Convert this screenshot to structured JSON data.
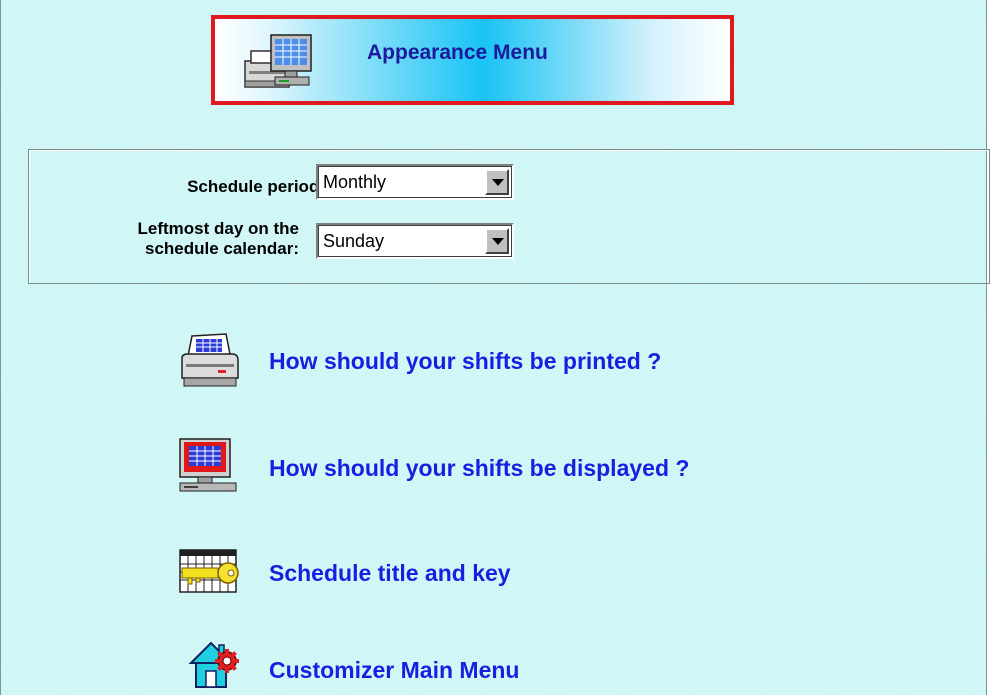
{
  "header": {
    "title": "Appearance Menu",
    "icon": "computer-printer-icon",
    "border_color": "#e01820",
    "title_color": "#1b1a9c"
  },
  "settings": {
    "schedule_period": {
      "label": "Schedule period:",
      "value": "Monthly"
    },
    "leftmost_day": {
      "label_line1": "Leftmost day on the",
      "label_line2": "schedule calendar:",
      "value": "Sunday"
    }
  },
  "menu": {
    "link_color": "#1a1ee0",
    "items": [
      {
        "label": "How should your shifts be printed ?",
        "icon": "printer-icon"
      },
      {
        "label": "How should your shifts be displayed ?",
        "icon": "monitor-icon"
      },
      {
        "label": "Schedule title and key",
        "icon": "calendar-key-icon"
      },
      {
        "label": "Customizer Main Menu",
        "icon": "home-gear-icon"
      }
    ]
  },
  "colors": {
    "background": "#ccf6f6"
  }
}
